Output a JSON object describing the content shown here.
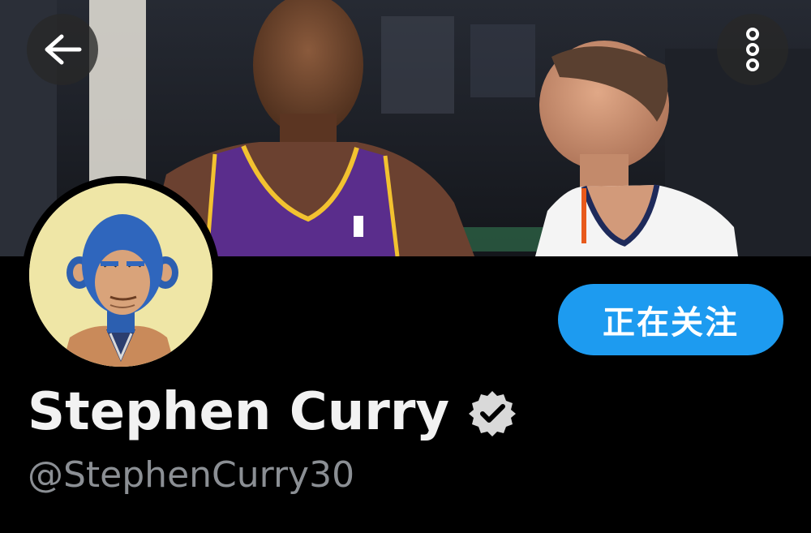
{
  "header": {
    "back_icon": "arrow-left-icon",
    "more_icon": "more-vertical-icon"
  },
  "profile": {
    "display_name": "Stephen Curry",
    "handle": "@StephenCurry30",
    "verified_icon": "verified-badge-icon",
    "follow_button_label": "正在关注"
  },
  "colors": {
    "background": "#000000",
    "accent": "#1d9bf0",
    "name_text": "#f2f2f2",
    "handle_text": "#8b8f94"
  }
}
